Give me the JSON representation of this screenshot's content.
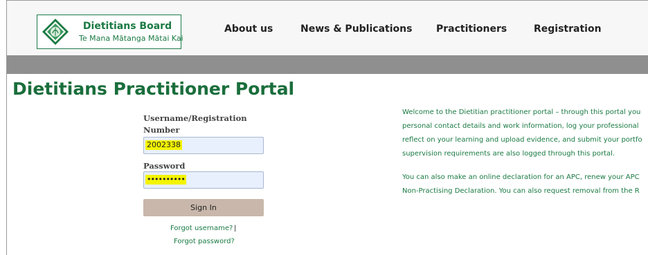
{
  "brand": {
    "title": "Dietitians Board",
    "subtitle": "Te Mana Mātanga Mātai Kai",
    "emblem": "dietitians-board-emblem",
    "color": "#1a7a43"
  },
  "nav": {
    "items": [
      {
        "label": "About us"
      },
      {
        "label": "News & Publications"
      },
      {
        "label": "Practitioners"
      },
      {
        "label": "Registration"
      }
    ]
  },
  "page": {
    "title": "Dietitians Practitioner Portal"
  },
  "login": {
    "username_label_line1": "Username/Registration",
    "username_label_line2": "Number",
    "username_value": "2002338",
    "password_label": "Password",
    "password_value": "••••••••••",
    "sign_in_label": "Sign In",
    "forgot_username": "Forgot username?",
    "separator": "|",
    "forgot_password": "Forgot password?"
  },
  "welcome": {
    "p1_lines": [
      "Welcome to the Dietitian practitioner portal – through this portal you",
      "personal contact details and work information, log your professional",
      "reflect on your learning and upload evidence, and submit your portfo",
      "supervision requirements are also logged through this portal."
    ],
    "p2_lines": [
      "You can also make an online declaration for an APC, renew your APC",
      "Non-Practising Declaration. You can also request removal from the R"
    ]
  },
  "colors": {
    "accent": "#1a7a43",
    "band": "#8f8f8f",
    "button": "#c8b7aa",
    "input": "#e8f0fe",
    "highlight": "#f4f400"
  }
}
